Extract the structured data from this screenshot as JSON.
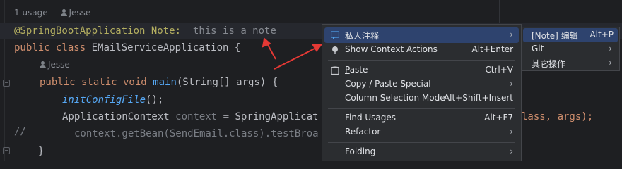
{
  "editor": {
    "usage_count": "1 usage",
    "author": "Jesse",
    "author2": "Jesse",
    "line1_annotation": "@SpringBootApplication",
    "note_label": "Note:",
    "note_text": "this is a note",
    "line2_kw": "public class",
    "line2_name": " EMailServiceApplication {",
    "line3_kw": "public static void",
    "line3_fn": "main",
    "line3_rest": "(String[] args) {",
    "line4_call": "initConfigFile",
    "line4_rest": "();",
    "line5_type": "ApplicationContext ",
    "line5_hint": "context",
    "line5_rest": " = SpringApplicat",
    "line5_tail": "lass, args);",
    "line6_comment_mark": "//",
    "line6_code": "context.getBean(SendEmail.class).testBroa",
    "line7": "}"
  },
  "context_menu": {
    "items": [
      {
        "label": "私人注释",
        "shortcut": "",
        "has_submenu": true,
        "icon": "comment-note-icon"
      },
      {
        "label": "Show Context Actions",
        "shortcut": "Alt+Enter",
        "has_submenu": false,
        "icon": "lightbulb-icon"
      },
      {
        "label": "Paste",
        "mnemonic": "P",
        "rest": "aste",
        "shortcut": "Ctrl+V",
        "has_submenu": false,
        "icon": "clipboard-icon"
      },
      {
        "label": "Copy / Paste Special",
        "shortcut": "",
        "has_submenu": true
      },
      {
        "label": "Column Selection Mode",
        "shortcut": "Alt+Shift+Insert",
        "has_submenu": false
      },
      {
        "label": "Find Usages",
        "shortcut": "Alt+F7",
        "has_submenu": false
      },
      {
        "label": "Refactor",
        "shortcut": "",
        "has_submenu": true
      },
      {
        "label": "Folding",
        "shortcut": "",
        "has_submenu": true
      }
    ],
    "arrow_glyph": "›"
  },
  "submenu": {
    "items": [
      {
        "label": "[Note] 编辑",
        "shortcut": "Alt+P"
      },
      {
        "label": "Git",
        "shortcut": ""
      },
      {
        "label": "其它操作",
        "shortcut": ""
      }
    ]
  },
  "colors": {
    "background": "#1e1f22",
    "menu_bg": "#2b2d30",
    "selection": "#2e436e",
    "annotation_arrow": "#e53935"
  }
}
